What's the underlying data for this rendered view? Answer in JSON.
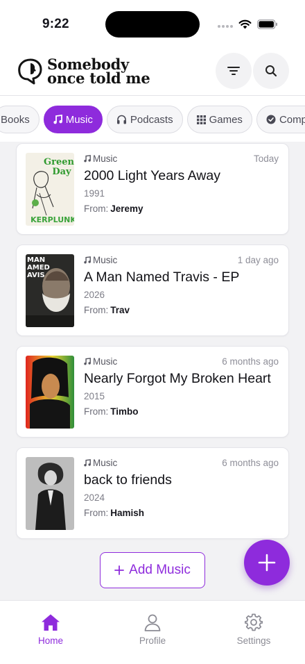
{
  "status_bar": {
    "time": "9:22"
  },
  "app": {
    "logo_line1": "Somebody",
    "logo_line2": "once told me"
  },
  "tabs": [
    {
      "label": "Books",
      "icon": "book-icon"
    },
    {
      "label": "Music",
      "icon": "music-note-icon",
      "active": true
    },
    {
      "label": "Podcasts",
      "icon": "headphones-icon"
    },
    {
      "label": "Games",
      "icon": "grid-icon"
    },
    {
      "label": "Completed",
      "icon": "check-circle-icon"
    }
  ],
  "items": [
    {
      "category": "Music",
      "time": "Today",
      "title": "2000 Light Years Away",
      "year": "1991",
      "from_label": "From:",
      "from": "Jeremy"
    },
    {
      "category": "Music",
      "time": "1 day ago",
      "title": "A Man Named Travis - EP",
      "year": "2026",
      "from_label": "From:",
      "from": "Trav"
    },
    {
      "category": "Music",
      "time": "6 months ago",
      "title": "Nearly Forgot My Broken Heart",
      "year": "2015",
      "from_label": "From:",
      "from": "Timbo"
    },
    {
      "category": "Music",
      "time": "6 months ago",
      "title": "back to friends",
      "year": "2024",
      "from_label": "From:",
      "from": "Hamish"
    }
  ],
  "covers": [
    {
      "lettering": [
        "Green",
        "Day",
        "KERPLUNK"
      ]
    },
    {
      "lettering": [
        "MAN",
        "AMED",
        "AVIS"
      ]
    },
    {
      "lettering": []
    },
    {
      "lettering": []
    }
  ],
  "add_button": {
    "label": "Add Music",
    "icon": "plus-icon"
  },
  "nav": [
    {
      "label": "Home",
      "icon": "home-icon",
      "active": true
    },
    {
      "label": "Profile",
      "icon": "person-icon"
    },
    {
      "label": "Settings",
      "icon": "gear-icon"
    }
  ],
  "colors": {
    "accent": "#8e2bdc",
    "background": "#f2f2f4"
  }
}
